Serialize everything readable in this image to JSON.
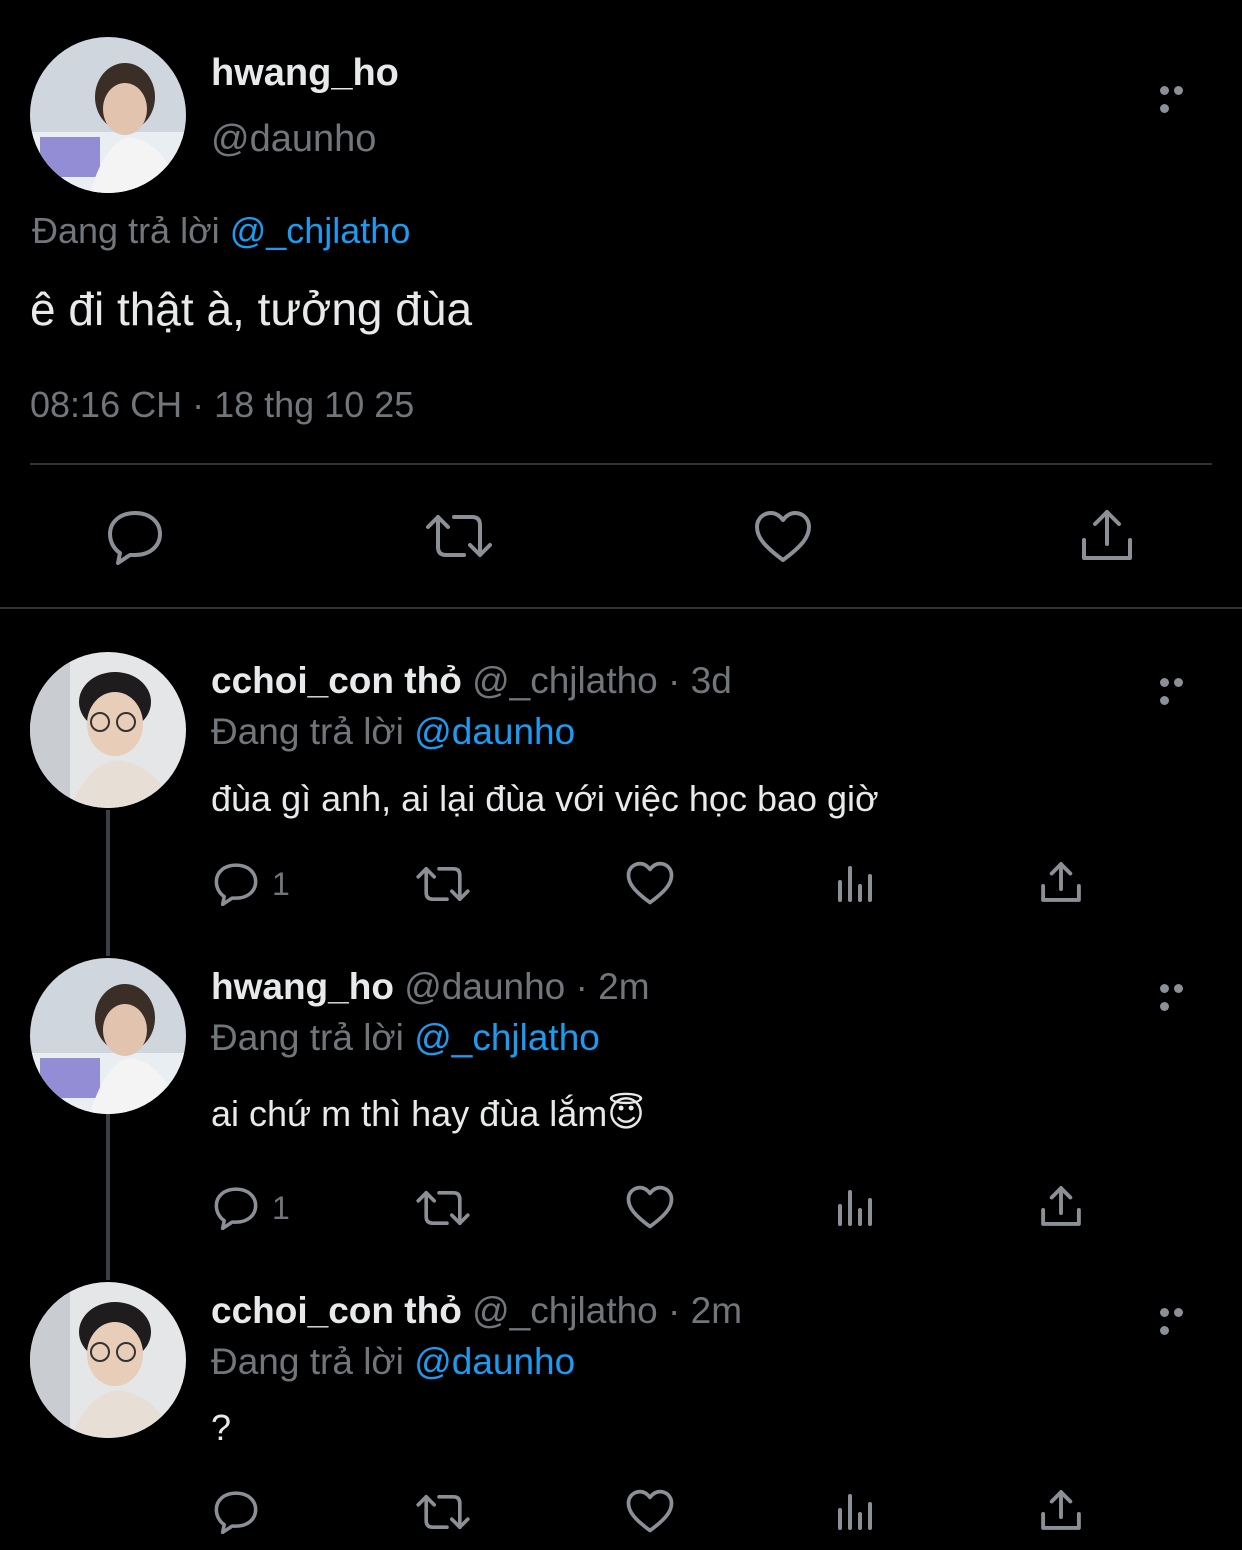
{
  "main_tweet": {
    "display_name": "hwang_ho",
    "handle": "@daunho",
    "reply_prefix": "Đang trả lời",
    "reply_to": "@_chjlatho",
    "text": "ê đi thật à, tưởng đùa",
    "timestamp": "08:16 CH · 18 thg 10 25",
    "actions": [
      "reply-icon",
      "retweet-icon",
      "like-icon",
      "share-icon"
    ]
  },
  "replies": [
    {
      "display_name": "cchoi_con thỏ",
      "handle": "@_chjlatho",
      "age": "· 3d",
      "reply_prefix": "Đang trả lời",
      "reply_to": "@daunho",
      "text": "đùa gì anh, ai lại đùa với việc học bao giờ",
      "reply_count": "1"
    },
    {
      "display_name": "hwang_ho",
      "handle": "@daunho",
      "age": "· 2m",
      "reply_prefix": "Đang trả lời",
      "reply_to": "@_chjlatho",
      "text": "ai chứ m thì hay đùa lắm😇",
      "reply_count": "1"
    },
    {
      "display_name": "cchoi_con thỏ",
      "handle": "@_chjlatho",
      "age": "· 2m",
      "reply_prefix": "Đang trả lời",
      "reply_to": "@daunho",
      "text": "?",
      "reply_count": ""
    }
  ],
  "colors": {
    "background": "#000000",
    "text": "#e7e9ea",
    "muted": "#71767b",
    "link": "#1d9bf0",
    "divider": "#2f3336"
  }
}
